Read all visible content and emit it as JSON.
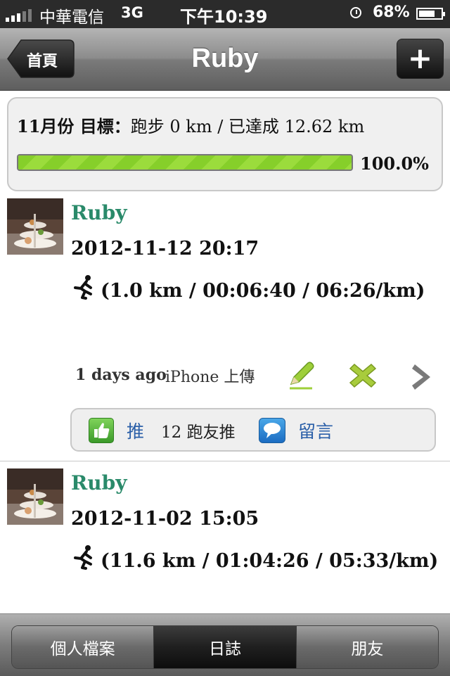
{
  "status_bar": {
    "carrier": "中華電信",
    "network": "3G",
    "time": "下午10:39",
    "battery": "68%",
    "battery_level": 0.68
  },
  "nav": {
    "back_label": "首頁",
    "title": "Ruby",
    "add_label": "+"
  },
  "goal": {
    "month_label": "11月份 目標：",
    "target_text": "跑步 0 km / 已達成 12.62 km",
    "progress_pct": "100.0%",
    "progress_value": 1.0
  },
  "entries": [
    {
      "user": "Ruby",
      "datetime": "2012-11-12 20:17",
      "stats": "(1.0 km / 00:06:40 / 06:26/km)",
      "ago": "1 days ago",
      "source": "iPhone 上傳",
      "like_label": "推",
      "like_count": "12 跑友推",
      "comment_label": "留言"
    },
    {
      "user": "Ruby",
      "datetime": "2012-11-02 15:05",
      "stats": "(11.6 km / 01:04:26 / 05:33/km)"
    }
  ],
  "tabs": [
    {
      "label": "個人檔案",
      "active": false
    },
    {
      "label": "日誌",
      "active": true
    },
    {
      "label": "朋友",
      "active": false
    }
  ],
  "colors": {
    "username": "#2a8a6a",
    "link": "#2a5fa8",
    "progress": "#86cf2a"
  },
  "icons": [
    "signal-icon",
    "alarm-icon",
    "battery-icon",
    "runner-icon",
    "pencil-icon",
    "delete-x-icon",
    "chevron-right-icon",
    "thumbs-up-icon",
    "comment-bubble-icon"
  ]
}
